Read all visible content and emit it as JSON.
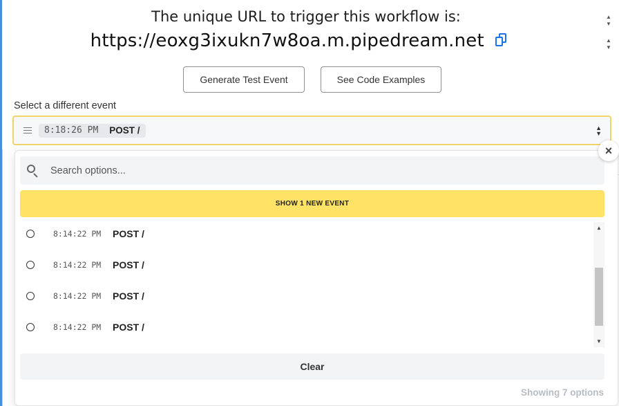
{
  "webhook": {
    "title": "The unique URL to trigger this workflow is:",
    "url": "https://eoxg3ixukn7w8oa.m.pipedream.net",
    "copy_icon": "copy-icon"
  },
  "buttons": {
    "generate": "Generate Test Event",
    "examples": "See Code Examples"
  },
  "event_select": {
    "label": "Select a different event",
    "selected_time": "8:18:26 PM",
    "selected_method": "POST /",
    "icon": "list-icon"
  },
  "dropdown": {
    "close_icon": "close-icon",
    "close_glyph": "×",
    "search_placeholder": "Search options...",
    "show_new_label": "SHOW 1 NEW EVENT",
    "items": [
      {
        "time": "8:14:22 PM",
        "method": "POST /"
      },
      {
        "time": "8:14:22 PM",
        "method": "POST /"
      },
      {
        "time": "8:14:22 PM",
        "method": "POST /"
      },
      {
        "time": "8:14:22 PM",
        "method": "POST /"
      }
    ],
    "clear_label": "Clear",
    "showing_text": "Showing 7 options"
  },
  "colors": {
    "accent_yellow": "#ffe266",
    "select_border": "#f0d46a",
    "copy_blue": "#1a73e8",
    "left_rule_blue": "#4a90d9"
  }
}
